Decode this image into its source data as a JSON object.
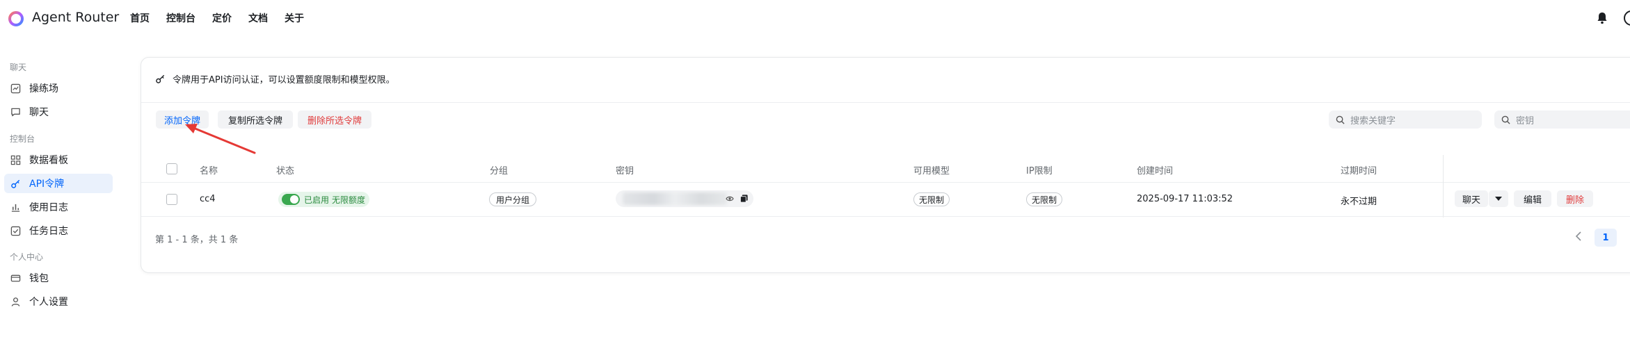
{
  "header": {
    "brand": "Agent Router",
    "nav": [
      "首页",
      "控制台",
      "定价",
      "文档",
      "关于"
    ]
  },
  "sidebar": {
    "sections": [
      {
        "label": "聊天"
      },
      {
        "label": "控制台"
      },
      {
        "label": "个人中心"
      }
    ],
    "items": [
      {
        "label": "操练场",
        "icon": "playground-icon"
      },
      {
        "label": "聊天",
        "icon": "chat-icon"
      },
      {
        "label": "数据看板",
        "icon": "dashboard-icon"
      },
      {
        "label": "API令牌",
        "icon": "key-icon",
        "active": true
      },
      {
        "label": "使用日志",
        "icon": "bar-chart-icon"
      },
      {
        "label": "任务日志",
        "icon": "task-check-icon"
      },
      {
        "label": "钱包",
        "icon": "wallet-icon"
      },
      {
        "label": "个人设置",
        "icon": "user-icon"
      }
    ]
  },
  "notice": "令牌用于API访问认证，可以设置额度限制和模型权限。",
  "toolbar": {
    "add_label": "添加令牌",
    "copy_label": "复制所选令牌",
    "delete_label": "删除所选令牌"
  },
  "search": {
    "keyword_placeholder": "搜索关键字",
    "key_placeholder": "密钥"
  },
  "table": {
    "headers": [
      "名称",
      "状态",
      "分组",
      "密钥",
      "可用模型",
      "IP限制",
      "创建时间",
      "过期时间"
    ],
    "rows": [
      {
        "name": "cc4",
        "status": "已启用",
        "quota": "无限额度",
        "group": "用户分组",
        "models": "无限制",
        "ip": "无限制",
        "created": "2025-09-17 11:03:52",
        "expires": "永不过期",
        "actions": {
          "chat": "聊天",
          "edit": "编辑",
          "delete": "删除"
        }
      }
    ]
  },
  "pagination": {
    "summary": "第 1 - 1 条，共 1 条",
    "current_page": "1"
  },
  "colors": {
    "accent": "#0064fa",
    "danger": "#e03b3b",
    "success": "#3aa84f",
    "annotation_arrow": "#e53935"
  }
}
